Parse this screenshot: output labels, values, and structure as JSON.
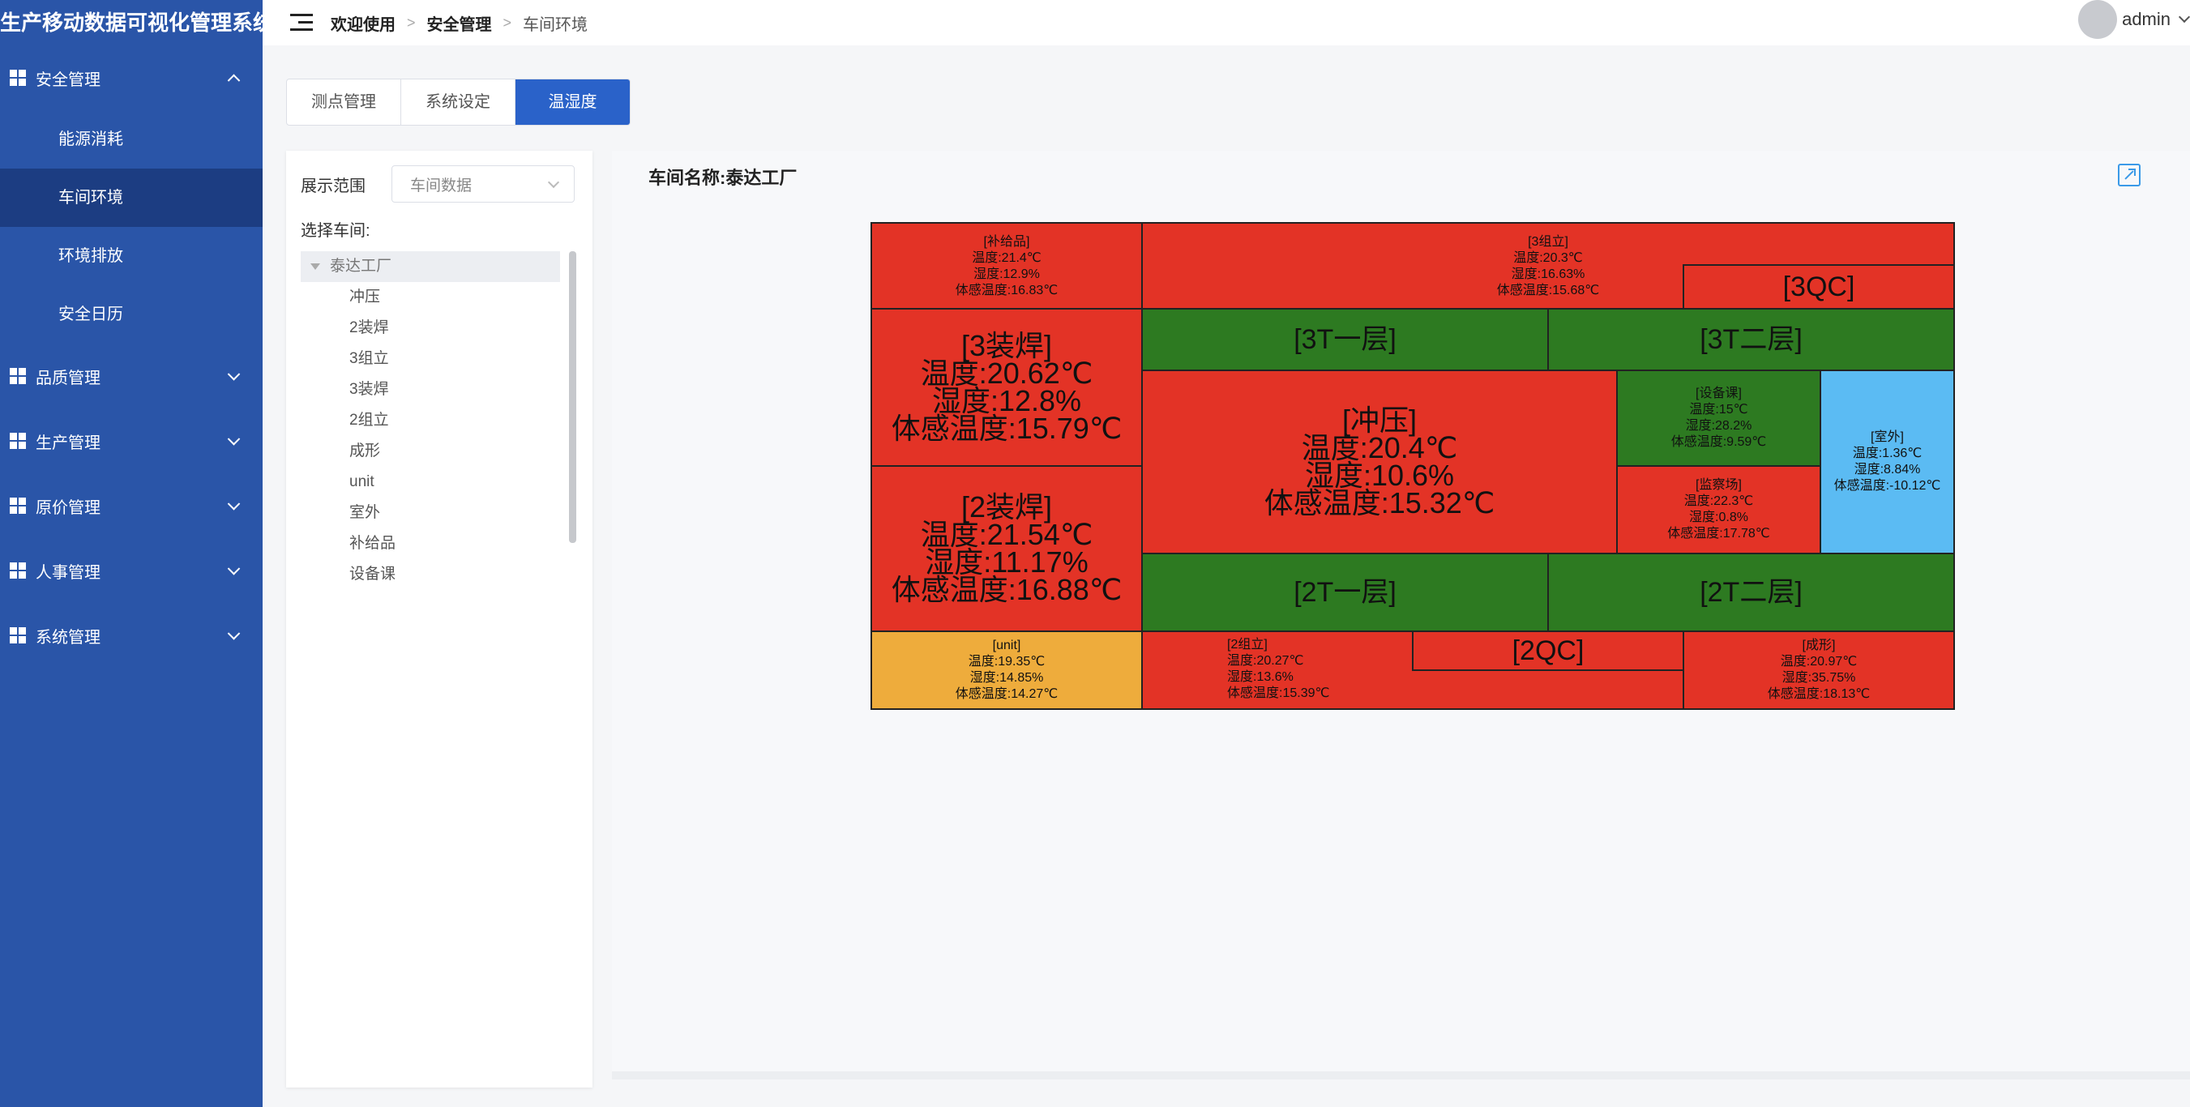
{
  "app_title": "生产移动数据可视化管理系统",
  "sidebar": {
    "groups": [
      {
        "label": "安全管理",
        "icon": "grid-icon",
        "expanded": true,
        "items": [
          {
            "label": "能源消耗"
          },
          {
            "label": "车间环境",
            "active": true
          },
          {
            "label": "环境排放"
          },
          {
            "label": "安全日历"
          }
        ]
      },
      {
        "label": "品质管理",
        "icon": "grid-icon"
      },
      {
        "label": "生产管理",
        "icon": "grid-icon"
      },
      {
        "label": "原价管理",
        "icon": "grid-icon"
      },
      {
        "label": "人事管理",
        "icon": "grid-icon"
      },
      {
        "label": "系统管理",
        "icon": "grid-icon"
      }
    ]
  },
  "header": {
    "breadcrumb": [
      "欢迎使用",
      "安全管理",
      "车间环境"
    ],
    "user": "admin"
  },
  "tabs": [
    {
      "label": "测点管理"
    },
    {
      "label": "系统设定"
    },
    {
      "label": "温湿度",
      "active": true
    }
  ],
  "filter": {
    "range_label": "展示范围",
    "range_value": "车间数据",
    "choose_label": "选择车间:",
    "tree_root": "泰达工厂",
    "tree_children": [
      "冲压",
      "2装焊",
      "3组立",
      "3装焊",
      "2组立",
      "成形",
      "unit",
      "室外",
      "补给品",
      "设备课"
    ]
  },
  "workshop_title": "车间名称:泰达工厂",
  "colors": {
    "red": "#e33326",
    "green": "#2d7a21",
    "blue": "#5bbbf3",
    "orange": "#eeac3c",
    "sidebar": "#2a55a8",
    "accent": "#2a62c9"
  },
  "treemap": {
    "supplies": {
      "l1": "[补给品]",
      "l2": "温度:21.4℃",
      "l3": "湿度:12.9%",
      "l4": "体感温度:16.83℃"
    },
    "assy3": {
      "l1": "[3组立]",
      "l2": "温度:20.3℃",
      "l3": "湿度:16.63%",
      "l4": "体感温度:15.68℃"
    },
    "qc3": {
      "l1": "[3QC]"
    },
    "weld3": {
      "l1": "[3装焊]",
      "l2": "温度:20.62℃",
      "l3": "湿度:12.8%",
      "l4": "体感温度:15.79℃"
    },
    "t3f1": {
      "l1": "[3T一层]"
    },
    "t3f2": {
      "l1": "[3T二层]"
    },
    "press": {
      "l1": "[冲压]",
      "l2": "温度:20.4℃",
      "l3": "湿度:10.6%",
      "l4": "体感温度:15.32℃"
    },
    "equip": {
      "l1": "[设备课]",
      "l2": "温度:15℃",
      "l3": "湿度:28.2%",
      "l4": "体感温度:9.59℃"
    },
    "outdoor": {
      "l1": "[室外]",
      "l2": "温度:1.36℃",
      "l3": "湿度:8.84%",
      "l4": "体感温度:-10.12℃"
    },
    "inspect": {
      "l1": "[监察场]",
      "l2": "温度:22.3℃",
      "l3": "湿度:0.8%",
      "l4": "体感温度:17.78℃"
    },
    "weld2": {
      "l1": "[2装焊]",
      "l2": "温度:21.54℃",
      "l3": "湿度:11.17%",
      "l4": "体感温度:16.88℃"
    },
    "t2f1": {
      "l1": "[2T一层]"
    },
    "t2f2": {
      "l1": "[2T二层]"
    },
    "unit": {
      "l1": "[unit]",
      "l2": "温度:19.35℃",
      "l3": "湿度:14.85%",
      "l4": "体感温度:14.27℃"
    },
    "assy2": {
      "l1": "[2组立]",
      "l2": "温度:20.27℃",
      "l3": "湿度:13.6%",
      "l4": "体感温度:15.39℃"
    },
    "qc2": {
      "l1": "[2QC]"
    },
    "forming": {
      "l1": "[成形]",
      "l2": "温度:20.97℃",
      "l3": "湿度:35.75%",
      "l4": "体感温度:18.13℃"
    }
  }
}
